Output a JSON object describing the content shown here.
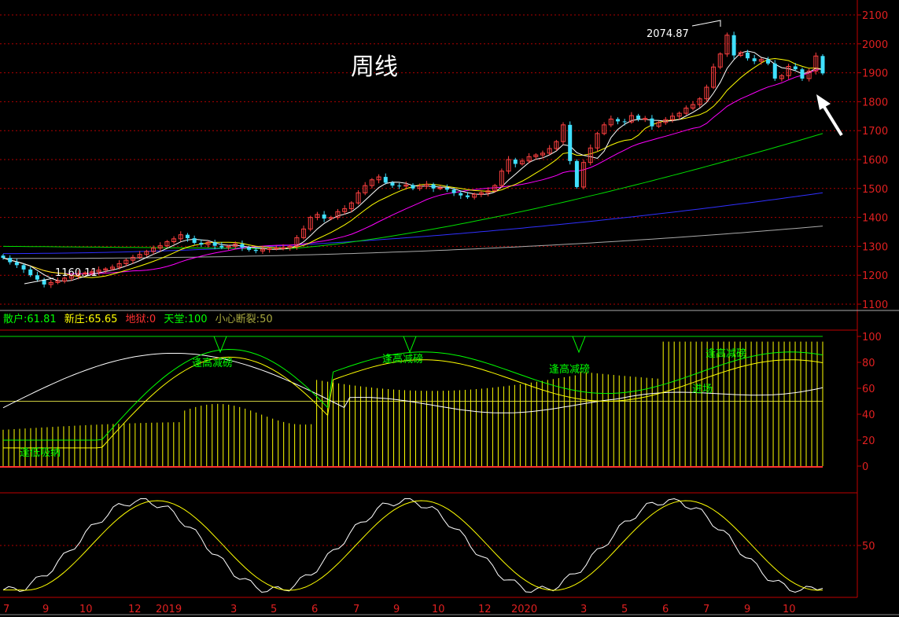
{
  "title": "周线",
  "price_axis": {
    "ticks": [
      "2100",
      "2000",
      "1900",
      "1800",
      "1700",
      "1600",
      "1500",
      "1400",
      "1300",
      "1200",
      "1100"
    ]
  },
  "price_marks": {
    "high": "2074.87",
    "low": "1160.11"
  },
  "indicators": [
    {
      "label": "散户:",
      "value": "61.81",
      "color": "#00ff00"
    },
    {
      "label": "新庄:",
      "value": "65.65",
      "color": "#ffff00"
    },
    {
      "label": "地狱:",
      "value": "0",
      "color": "#ff3030"
    },
    {
      "label": "天堂:",
      "value": "100",
      "color": "#00ff00"
    },
    {
      "label": "小心断裂:",
      "value": "50",
      "color": "#aaaa40"
    }
  ],
  "osc_axis": {
    "ticks": [
      "100",
      "80",
      "60",
      "40",
      "20",
      "0"
    ]
  },
  "osc_annotations": [
    "逢高减磅",
    "逢高减磅",
    "逢高减磅",
    "逢高减磅",
    "逢低吸纳",
    "进场"
  ],
  "kd_axis": {
    "ticks": [
      "50"
    ]
  },
  "time_axis": {
    "labels": [
      "7",
      "9",
      "10",
      "12",
      "2019",
      "3",
      "5",
      "6",
      "7",
      "9",
      "10",
      "12",
      "2020",
      "3",
      "5",
      "6",
      "7",
      "9",
      "10"
    ]
  },
  "colors": {
    "up": "#ff4040",
    "down": "#40e0ff",
    "grid": "#b00000",
    "axis": "#c00000",
    "ma5": "#ffffff",
    "ma10": "#ffff00",
    "ma20": "#ff00ff",
    "ma60": "#00dd00",
    "ma120": "#3030ff",
    "ma250": "#aaaaaa"
  },
  "chart_data": [
    {
      "type": "candlestick",
      "title": "周线",
      "ylim": [
        1100,
        2100
      ],
      "max_label": 2074.87,
      "min_label": 1160.11,
      "close": [
        1260,
        1245,
        1235,
        1220,
        1200,
        1185,
        1168,
        1175,
        1180,
        1190,
        1198,
        1205,
        1208,
        1212,
        1218,
        1222,
        1228,
        1240,
        1252,
        1262,
        1272,
        1282,
        1294,
        1302,
        1316,
        1326,
        1340,
        1328,
        1312,
        1306,
        1314,
        1302,
        1296,
        1300,
        1308,
        1296,
        1288,
        1284,
        1290,
        1292,
        1294,
        1295,
        1300,
        1330,
        1360,
        1400,
        1410,
        1396,
        1400,
        1420,
        1430,
        1450,
        1485,
        1510,
        1530,
        1540,
        1520,
        1510,
        1508,
        1512,
        1500,
        1508,
        1514,
        1500,
        1502,
        1496,
        1484,
        1476,
        1470,
        1480,
        1485,
        1492,
        1510,
        1560,
        1600,
        1585,
        1595,
        1610,
        1616,
        1622,
        1638,
        1662,
        1720,
        1595,
        1505,
        1590,
        1640,
        1690,
        1720,
        1740,
        1732,
        1730,
        1752,
        1740,
        1742,
        1715,
        1728,
        1738,
        1750,
        1760,
        1778,
        1790,
        1810,
        1850,
        1920,
        1965,
        2030,
        1960,
        1970,
        1950,
        1940,
        1946,
        1932,
        1880,
        1890,
        1922,
        1912,
        1880,
        1906,
        1958,
        1898
      ],
      "series": [
        {
          "name": "MA5",
          "values": []
        },
        {
          "name": "MA10",
          "values": []
        },
        {
          "name": "MA20",
          "values": []
        },
        {
          "name": "MA60",
          "values": []
        },
        {
          "name": "MA120",
          "values": []
        },
        {
          "name": "MA250",
          "values": []
        }
      ],
      "ma_endpoints": {
        "MA20": 1855,
        "MA60": 1690,
        "MA120": 1485,
        "MA250": 1370
      }
    },
    {
      "type": "bar+line",
      "ylim": [
        0,
        100
      ],
      "reference_lines": [
        0,
        50,
        100
      ],
      "last_values": {
        "散户": 61.81,
        "新庄": 65.65,
        "地狱": 0,
        "天堂": 100,
        "小心断裂": 50
      }
    },
    {
      "type": "line",
      "ytick": 50
    }
  ]
}
